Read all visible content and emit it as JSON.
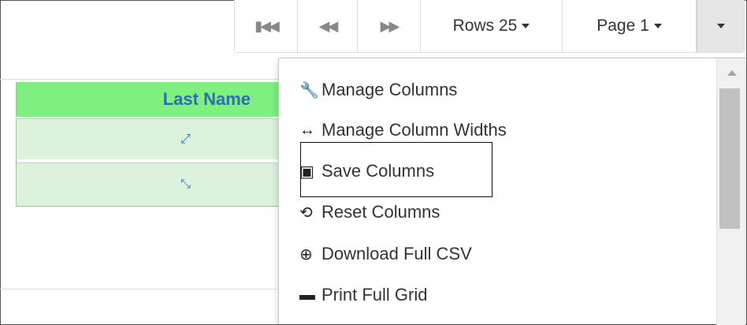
{
  "toolbar": {
    "first_icon": "⏮",
    "prev_icon": "⏪",
    "next_icon": "⏩",
    "rows_label": "Rows 25",
    "page_label": "Page 1"
  },
  "grid": {
    "column_header": "Last Name",
    "rows": [
      {
        "icon": "expand-arrows-icon",
        "glyph": "⤢"
      },
      {
        "icon": "compress-arrows-icon",
        "glyph": "⤡"
      }
    ]
  },
  "menu": {
    "items": [
      {
        "label": "Manage Columns",
        "icon": "wrench-icon",
        "glyph": "🔧"
      },
      {
        "label": "Manage Column Widths",
        "icon": "horizontal-arrows-icon",
        "glyph": "↔"
      },
      {
        "label": "Save Columns",
        "icon": "save-icon",
        "glyph": "💾"
      },
      {
        "label": "Reset Columns",
        "icon": "refresh-icon",
        "glyph": "⟲"
      },
      {
        "label": "Download Full CSV",
        "icon": "download-circle-icon",
        "glyph": "⊕"
      },
      {
        "label": "Print Full Grid",
        "icon": "print-icon",
        "glyph": "🖶"
      }
    ]
  }
}
